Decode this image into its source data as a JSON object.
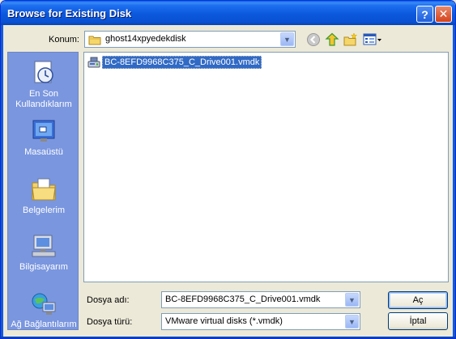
{
  "window": {
    "title": "Browse for Existing Disk",
    "help_glyph": "?",
    "close_glyph": "✕"
  },
  "location": {
    "label": "Konum:",
    "value": "ghost14xpyedekdisk"
  },
  "places": [
    {
      "label": "En Son Kullandıklarım",
      "icon": "recent-documents-icon"
    },
    {
      "label": "Masaüstü",
      "icon": "desktop-icon"
    },
    {
      "label": "Belgelerim",
      "icon": "my-documents-icon"
    },
    {
      "label": "Bilgisayarım",
      "icon": "my-computer-icon"
    },
    {
      "label": "Ağ Bağlantılarım",
      "icon": "network-places-icon"
    }
  ],
  "files": [
    {
      "name": "BC-8EFD9968C375_C_Drive001.vmdk",
      "icon": "vmdk-disk-icon"
    }
  ],
  "filename": {
    "label": "Dosya adı:",
    "value": "BC-8EFD9968C375_C_Drive001.vmdk"
  },
  "filetype": {
    "label": "Dosya türü:",
    "value": "VMware virtual disks (*.vmdk)"
  },
  "buttons": {
    "open": "Aç",
    "cancel": "İptal"
  },
  "colors": {
    "title_bar": "#0a52d4",
    "places_bar": "#7a96df",
    "selection": "#316ac5"
  }
}
